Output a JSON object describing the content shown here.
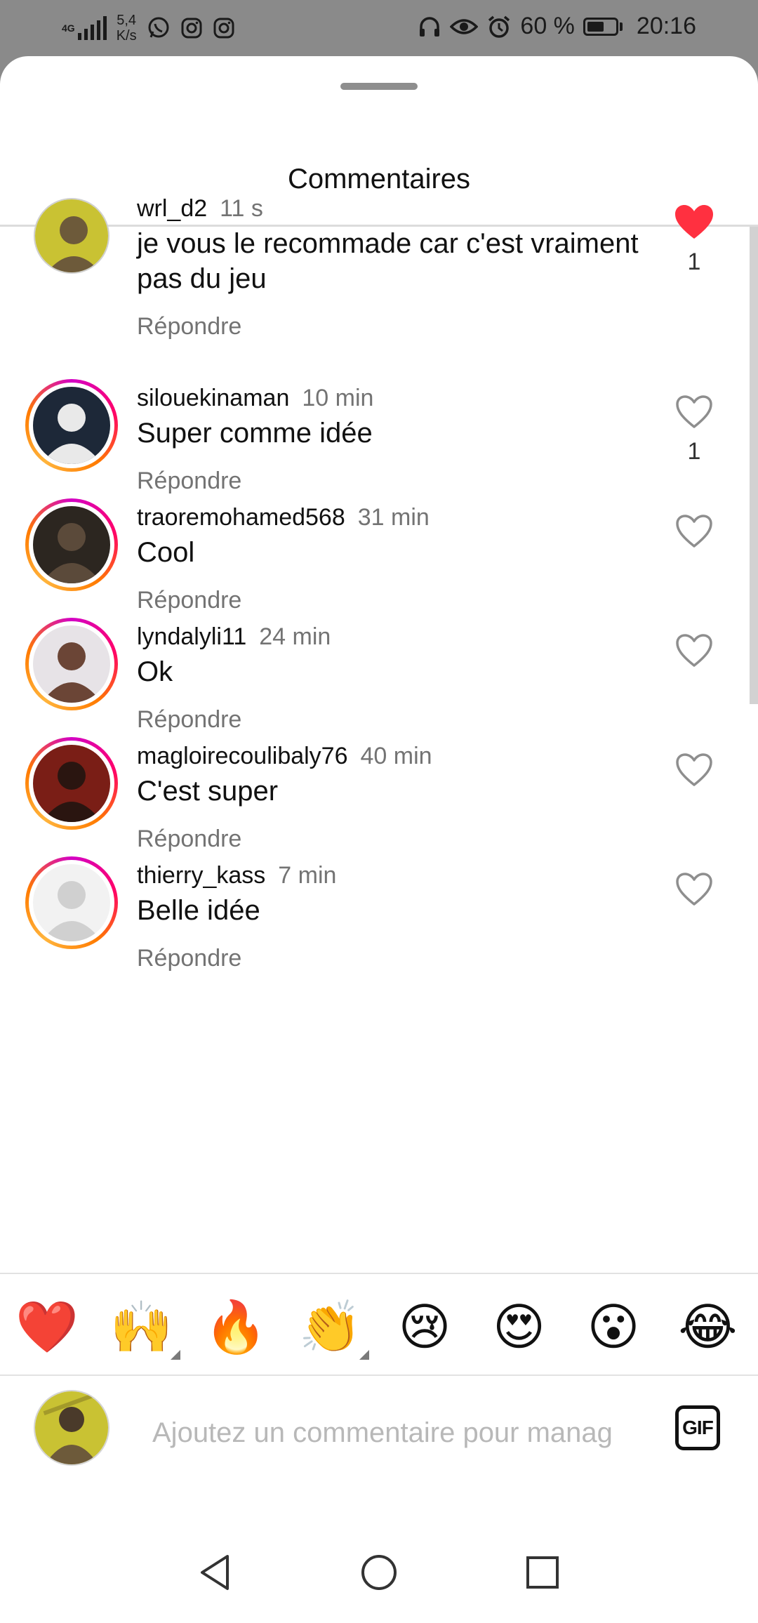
{
  "status_bar": {
    "network": "4G",
    "speed_value": "5,4",
    "speed_unit": "K/s",
    "battery_percent": "60 %",
    "battery_level": 0.6,
    "time": "20:16",
    "left_icons": [
      "whatsapp-icon",
      "instagram-icon",
      "instagram-icon"
    ],
    "right_icons": [
      "headphones-icon",
      "eye-icon",
      "alarm-icon",
      "battery-icon"
    ]
  },
  "sheet": {
    "title": "Commentaires"
  },
  "comments": [
    {
      "username": "wrl_d2",
      "time": "11 s",
      "text": "je vous le recommade car c'est vraiment pas du jeu",
      "reply_label": "Répondre",
      "liked": true,
      "likes": "1",
      "avatar_story_ring": false,
      "avatar_colors": [
        "#c9c233",
        "#6d5a3a"
      ]
    },
    {
      "username": "silouekinaman",
      "time": "10 min",
      "text": "Super comme idée",
      "reply_label": "Répondre",
      "liked": false,
      "likes": "1",
      "avatar_story_ring": true,
      "avatar_colors": [
        "#1d2838",
        "#e9e9e9"
      ]
    },
    {
      "username": "traoremohamed568",
      "time": "31 min",
      "text": "Cool",
      "reply_label": "Répondre",
      "liked": false,
      "likes": "",
      "avatar_story_ring": true,
      "avatar_colors": [
        "#2c2620",
        "#5b4a3a"
      ]
    },
    {
      "username": "lyndalyli11",
      "time": "24 min",
      "text": "Ok",
      "reply_label": "Répondre",
      "liked": false,
      "likes": "",
      "avatar_story_ring": true,
      "avatar_colors": [
        "#e7e3e7",
        "#6b4536"
      ]
    },
    {
      "username": "magloirecoulibaly76",
      "time": "40 min",
      "text": "C'est super",
      "reply_label": "Répondre",
      "liked": false,
      "likes": "",
      "avatar_story_ring": true,
      "avatar_colors": [
        "#7a1e16",
        "#2a1510"
      ]
    },
    {
      "username": "thierry_kass",
      "time": "7 min",
      "text": "Belle idée",
      "reply_label": "Répondre",
      "liked": false,
      "likes": "",
      "avatar_story_ring": true,
      "avatar_colors": [
        "#f2f2f2",
        "#d0d0d0"
      ]
    }
  ],
  "emoji_bar": [
    {
      "glyph": "❤️",
      "name": "red-heart",
      "has_variants": false
    },
    {
      "glyph": "🙌",
      "name": "raising-hands",
      "has_variants": true
    },
    {
      "glyph": "🔥",
      "name": "fire",
      "has_variants": false
    },
    {
      "glyph": "👏",
      "name": "clapping-hands",
      "has_variants": true
    },
    {
      "glyph": "😢",
      "name": "crying-face",
      "has_variants": false
    },
    {
      "glyph": "😍",
      "name": "heart-eyes",
      "has_variants": false
    },
    {
      "glyph": "😮",
      "name": "surprised-face",
      "has_variants": false
    },
    {
      "glyph": "😂",
      "name": "tears-of-joy",
      "has_variants": false
    }
  ],
  "compose": {
    "placeholder": "Ajoutez un commentaire pour manag",
    "gif_label": "GIF"
  },
  "nav_bar": {
    "icons": [
      "back-triangle-icon",
      "home-circle-icon",
      "recents-square-icon"
    ]
  },
  "colors": {
    "like_red": "#ff3040",
    "secondary_text": "#737373",
    "story_ring_start": "#d300c5",
    "story_ring_end": "#ff7a00"
  }
}
